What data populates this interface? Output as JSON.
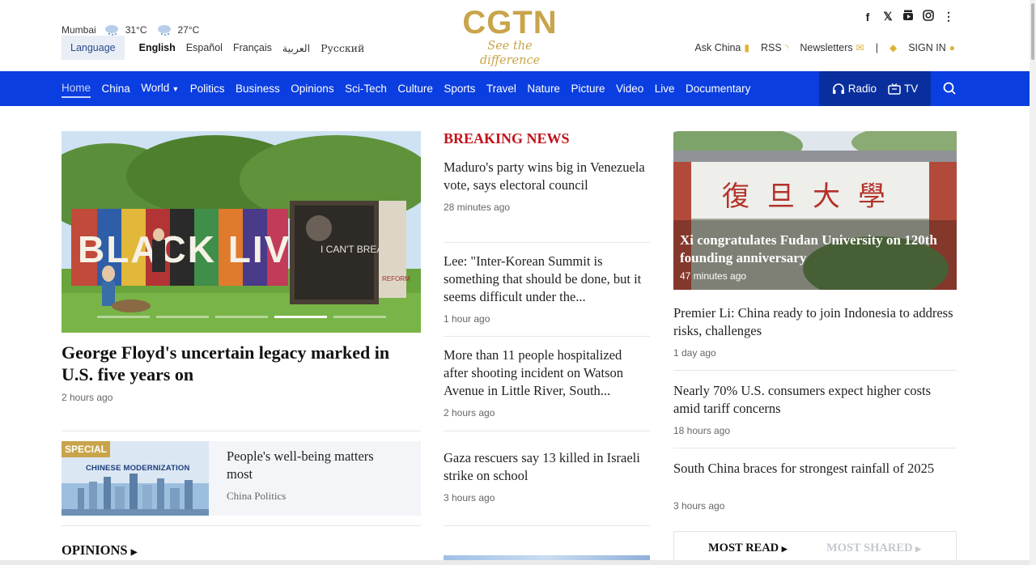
{
  "header": {
    "weather": {
      "city": "Mumbai",
      "temps": [
        "31°C",
        "27°C"
      ],
      "icon": "rain-cloud-icon"
    },
    "language_button": "Language",
    "languages": [
      "English",
      "Español",
      "Français",
      "العربية",
      "Русский"
    ],
    "active_language": "English",
    "logo": {
      "text": "CGTN",
      "tagline": "See the difference",
      "color": "#c9a44a"
    },
    "social_icons": [
      "facebook-icon",
      "x-icon",
      "youtube-icon",
      "instagram-icon",
      "more-icon"
    ],
    "links": {
      "ask_china": "Ask China",
      "rss": "RSS",
      "newsletters": "Newsletters",
      "sign_in": "SIGN IN"
    }
  },
  "nav": {
    "color": "#0a3ee0",
    "items": [
      "Home",
      "China",
      "World",
      "Politics",
      "Business",
      "Opinions",
      "Sci-Tech",
      "Culture",
      "Sports",
      "Travel",
      "Nature",
      "Picture",
      "Video",
      "Live",
      "Documentary"
    ],
    "active": "Home",
    "radio": "Radio",
    "tv": "TV"
  },
  "hero": {
    "title": "George Floyd's uncertain legacy marked in U.S. five years on",
    "time": "2 hours ago",
    "mural_text": "BLACK LIVES",
    "sign_text": "I CAN'T BREATHE",
    "sign_small": "REFORM"
  },
  "special": {
    "badge": "SPECIAL",
    "banner": "CHINESE MODERNIZATION",
    "title": "People's well-being matters most",
    "category": "China Politics"
  },
  "opinions_heading": "OPINIONS",
  "breaking": {
    "heading": "BREAKING NEWS",
    "color": "#c0131b",
    "stories": [
      {
        "title": "Maduro's party wins big in Venezuela vote, says electoral council",
        "time": "28 minutes ago"
      },
      {
        "title": "Lee: \"Inter-Korean Summit is something that should be done, but it seems difficult under the...",
        "time": "1 hour ago"
      },
      {
        "title": "More than 11 people hospitalized after shooting incident on Watson Avenue in Little River, South...",
        "time": "2 hours ago"
      },
      {
        "title": "Gaza rescuers say 13 killed in Israeli strike on school",
        "time": "3 hours ago"
      }
    ]
  },
  "feature": {
    "title": "Xi congratulates Fudan University on 120th founding anniversary",
    "time": "47 minutes ago",
    "gate_text": "復旦大學"
  },
  "right_stories": [
    {
      "title": "Premier Li: China ready to join Indonesia to address risks, challenges",
      "time": "1 day ago"
    },
    {
      "title": "Nearly 70% U.S. consumers expect higher costs amid tariff concerns",
      "time": "18 hours ago"
    },
    {
      "title": "South China braces for strongest rainfall of 2025",
      "time": "3 hours ago"
    }
  ],
  "tabs": {
    "most_read": "MOST READ",
    "most_shared": "MOST SHARED"
  }
}
